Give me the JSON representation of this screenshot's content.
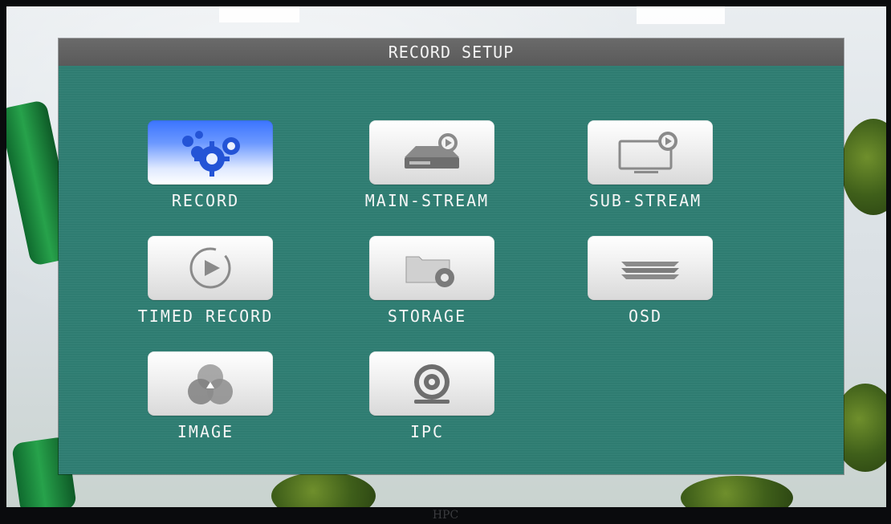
{
  "window": {
    "title": "RECORD SETUP"
  },
  "monitor": {
    "brand": "HPC"
  },
  "menu": {
    "items": [
      {
        "label": "RECORD",
        "icon": "gears-icon",
        "selected": true
      },
      {
        "label": "MAIN-STREAM",
        "icon": "hard-drive-stream-icon",
        "selected": false
      },
      {
        "label": "SUB-STREAM",
        "icon": "monitor-stream-icon",
        "selected": false
      },
      {
        "label": "TIMED RECORD",
        "icon": "timer-play-icon",
        "selected": false
      },
      {
        "label": "STORAGE",
        "icon": "folder-gear-icon",
        "selected": false
      },
      {
        "label": "OSD",
        "icon": "layers-icon",
        "selected": false
      },
      {
        "label": "IMAGE",
        "icon": "color-circles-icon",
        "selected": false
      },
      {
        "label": "IPC",
        "icon": "camera-icon",
        "selected": false
      }
    ]
  },
  "colors": {
    "dialog_bg": "#2e7d72",
    "titlebar_bg": "#5f5f5f",
    "selected_accent": "#3b74ff",
    "tile_bg": "#f1f1f1",
    "label_text": "#f6f6f6"
  }
}
